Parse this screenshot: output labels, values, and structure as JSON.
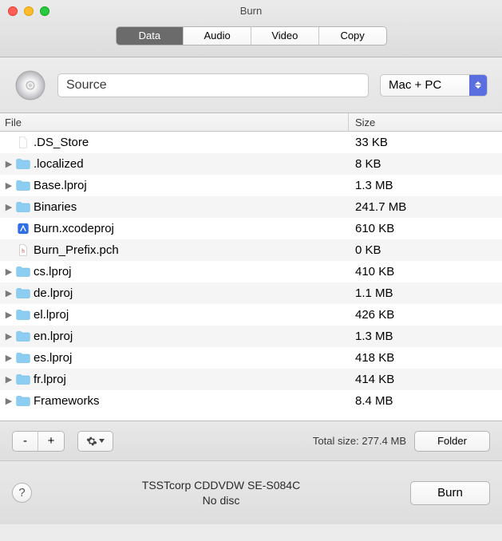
{
  "window": {
    "title": "Burn"
  },
  "tabs": [
    {
      "label": "Data",
      "selected": true
    },
    {
      "label": "Audio",
      "selected": false
    },
    {
      "label": "Video",
      "selected": false
    },
    {
      "label": "Copy",
      "selected": false
    }
  ],
  "source": {
    "value": "Source"
  },
  "format": {
    "selected": "Mac + PC"
  },
  "columns": {
    "file": "File",
    "size": "Size"
  },
  "files": [
    {
      "name": ".DS_Store",
      "size": "33 KB",
      "type": "file",
      "icon": "blank-file"
    },
    {
      "name": ".localized",
      "size": "8 KB",
      "type": "folder",
      "icon": "folder"
    },
    {
      "name": "Base.lproj",
      "size": "1.3 MB",
      "type": "folder",
      "icon": "folder"
    },
    {
      "name": "Binaries",
      "size": "241.7 MB",
      "type": "folder",
      "icon": "folder"
    },
    {
      "name": "Burn.xcodeproj",
      "size": "610 KB",
      "type": "file",
      "icon": "xcode-project"
    },
    {
      "name": "Burn_Prefix.pch",
      "size": "0 KB",
      "type": "file",
      "icon": "header-file"
    },
    {
      "name": "cs.lproj",
      "size": "410 KB",
      "type": "folder",
      "icon": "folder"
    },
    {
      "name": "de.lproj",
      "size": "1.1 MB",
      "type": "folder",
      "icon": "folder"
    },
    {
      "name": "el.lproj",
      "size": "426 KB",
      "type": "folder",
      "icon": "folder"
    },
    {
      "name": "en.lproj",
      "size": "1.3 MB",
      "type": "folder",
      "icon": "folder"
    },
    {
      "name": "es.lproj",
      "size": "418 KB",
      "type": "folder",
      "icon": "folder"
    },
    {
      "name": "fr.lproj",
      "size": "414 KB",
      "type": "folder",
      "icon": "folder"
    },
    {
      "name": "Frameworks",
      "size": "8.4 MB",
      "type": "folder",
      "icon": "folder"
    }
  ],
  "buttons": {
    "remove": "-",
    "add": "+",
    "folder": "Folder",
    "burn": "Burn",
    "help": "?"
  },
  "total": {
    "label": "Total size:",
    "value": "277.4 MB"
  },
  "device": {
    "name": "TSSTcorp CDDVDW SE-S084C",
    "status": "No disc"
  }
}
